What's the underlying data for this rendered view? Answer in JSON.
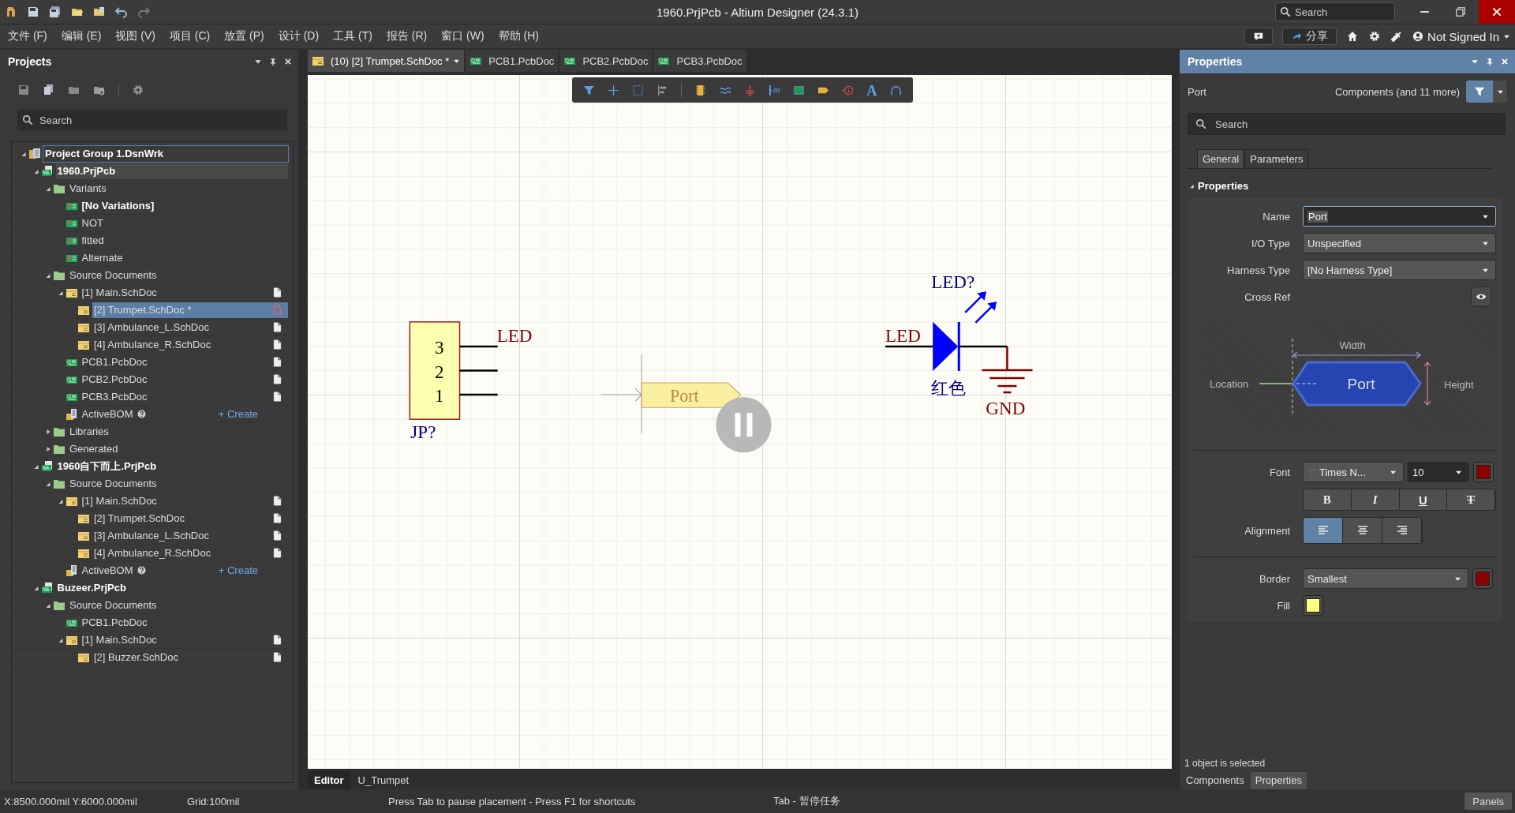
{
  "window": {
    "title": "1960.PrjPcb - Altium Designer (24.3.1)",
    "search_placeholder": "Search"
  },
  "header_actions": {
    "share": "分享",
    "account": "Not Signed In"
  },
  "menu": [
    "文件 (F)",
    "编辑 (E)",
    "视图 (V)",
    "项目 (C)",
    "放置 (P)",
    "设计 (D)",
    "工具 (T)",
    "报告 (R)",
    "窗口 (W)",
    "帮助 (H)"
  ],
  "projects_panel": {
    "title": "Projects",
    "search_placeholder": "Search",
    "tree": [
      {
        "label": "Project Group 1.DsnWrk",
        "kind": "group",
        "expanded": true,
        "selected": false,
        "children": [
          {
            "label": "1960.PrjPcb",
            "kind": "project",
            "expanded": true,
            "active": true,
            "selected": false,
            "children": [
              {
                "label": "Variants",
                "kind": "folder",
                "expanded": true,
                "selected": false,
                "children": [
                  {
                    "label": "[No Variations]",
                    "kind": "variant",
                    "active": true,
                    "selected": false
                  },
                  {
                    "label": "NOT",
                    "kind": "variant",
                    "active": false,
                    "selected": false
                  },
                  {
                    "label": "fitted",
                    "kind": "variant",
                    "active": false,
                    "selected": false
                  },
                  {
                    "label": "Alternate",
                    "kind": "variant",
                    "active": false,
                    "selected": false
                  }
                ]
              },
              {
                "label": "Source Documents",
                "kind": "folder",
                "expanded": true,
                "selected": false,
                "children": [
                  {
                    "label": "[1] Main.SchDoc",
                    "kind": "sch",
                    "modified": false,
                    "expanded": true,
                    "selected": false,
                    "children": [
                      {
                        "label": "[2] Trumpet.SchDoc *",
                        "kind": "sch",
                        "modified": true,
                        "selected": true
                      },
                      {
                        "label": "[3] Ambulance_L.SchDoc",
                        "kind": "sch",
                        "modified": false,
                        "selected": false
                      },
                      {
                        "label": "[4] Ambulance_R.SchDoc",
                        "kind": "sch",
                        "modified": false,
                        "selected": false
                      }
                    ]
                  },
                  {
                    "label": "PCB1.PcbDoc",
                    "kind": "pcb",
                    "modified": false,
                    "selected": false
                  },
                  {
                    "label": "PCB2.PcbDoc",
                    "kind": "pcb",
                    "modified": false,
                    "selected": false
                  },
                  {
                    "label": "PCB3.PcbDoc",
                    "kind": "pcb",
                    "modified": false,
                    "selected": false
                  },
                  {
                    "label": "ActiveBOM",
                    "kind": "bom",
                    "action": "+ Create",
                    "selected": false
                  }
                ]
              },
              {
                "label": "Libraries",
                "kind": "folder",
                "expanded": false,
                "selected": false
              },
              {
                "label": "Generated",
                "kind": "folder",
                "expanded": false,
                "selected": false
              }
            ]
          },
          {
            "label": "1960自下而上.PrjPcb",
            "kind": "project",
            "expanded": true,
            "active": false,
            "selected": false,
            "children": [
              {
                "label": "Source Documents",
                "kind": "folder",
                "expanded": true,
                "selected": false,
                "children": [
                  {
                    "label": "[1] Main.SchDoc",
                    "kind": "sch",
                    "modified": false,
                    "expanded": true,
                    "selected": false,
                    "children": [
                      {
                        "label": "[2] Trumpet.SchDoc",
                        "kind": "sch",
                        "modified": false,
                        "selected": false
                      },
                      {
                        "label": "[3] Ambulance_L.SchDoc",
                        "kind": "sch",
                        "modified": false,
                        "selected": false
                      },
                      {
                        "label": "[4] Ambulance_R.SchDoc",
                        "kind": "sch",
                        "modified": false,
                        "selected": false
                      }
                    ]
                  },
                  {
                    "label": "ActiveBOM",
                    "kind": "bom",
                    "action": "+ Create",
                    "selected": false
                  }
                ]
              }
            ]
          },
          {
            "label": "Buzeer.PrjPcb",
            "kind": "project",
            "expanded": true,
            "active": false,
            "selected": false,
            "children": [
              {
                "label": "Source Documents",
                "kind": "folder",
                "expanded": true,
                "selected": false,
                "children": [
                  {
                    "label": "PCB1.PcbDoc",
                    "kind": "pcb",
                    "selected": false
                  },
                  {
                    "label": "[1] Main.SchDoc",
                    "kind": "sch",
                    "modified": false,
                    "expanded": true,
                    "selected": false,
                    "children": [
                      {
                        "label": "[2] Buzzer.SchDoc",
                        "kind": "sch",
                        "modified": false,
                        "selected": false
                      }
                    ]
                  }
                ]
              }
            ]
          }
        ]
      }
    ]
  },
  "document_tabs": [
    {
      "label": "(10) [2] Trumpet.SchDoc *",
      "kind": "sch",
      "selected": true
    },
    {
      "label": "PCB1.PcbDoc",
      "kind": "pcb",
      "selected": false
    },
    {
      "label": "PCB2.PcbDoc",
      "kind": "pcb",
      "selected": false
    },
    {
      "label": "PCB3.PcbDoc",
      "kind": "pcb",
      "selected": false
    }
  ],
  "schematic_toolbar": {
    "text_tool": "A"
  },
  "schematic": {
    "connector": {
      "designator": "JP?",
      "pins": [
        "3",
        "2",
        "1"
      ],
      "net_label": "LED"
    },
    "port": {
      "name": "Port"
    },
    "led": {
      "designator": "LED?",
      "net_label": "LED",
      "comment": "红色",
      "power_port": "GND"
    }
  },
  "editor_tabs": [
    {
      "label": "Editor",
      "selected": true
    },
    {
      "label": "U_Trumpet",
      "selected": false
    }
  ],
  "properties_panel": {
    "title": "Properties",
    "object": "Port",
    "filter": "Components (and 11 more)",
    "search_placeholder": "Search",
    "tabs": [
      {
        "label": "General",
        "selected": true
      },
      {
        "label": "Parameters",
        "selected": false
      }
    ],
    "section": "Properties",
    "fields": [
      {
        "label": "Name",
        "kind": "input",
        "value": "Port"
      },
      {
        "label": "I/O Type",
        "kind": "select",
        "value": "Unspecified"
      },
      {
        "label": "Harness Type",
        "kind": "select",
        "value": "[No Harness Type]"
      },
      {
        "label": "Cross Ref",
        "kind": "eye"
      }
    ],
    "diagram": {
      "width": "Width",
      "location": "Location",
      "port": "Port",
      "height": "Height"
    },
    "font": {
      "label": "Font",
      "family": "Times N...",
      "size": "10",
      "color": "#8b0000"
    },
    "styles": [
      {
        "kind": "bold",
        "glyph": "B"
      },
      {
        "kind": "italic",
        "glyph": "I"
      },
      {
        "kind": "underline",
        "glyph": "U"
      },
      {
        "kind": "strike",
        "glyph": "T"
      }
    ],
    "alignment": {
      "label": "Alignment",
      "options": [
        {
          "kind": "left",
          "selected": true
        },
        {
          "kind": "center",
          "selected": false
        },
        {
          "kind": "right",
          "selected": false
        }
      ]
    },
    "border": {
      "label": "Border",
      "value": "Smallest",
      "color": "#8b0000"
    },
    "fill": {
      "label": "Fill",
      "color": "#ffff80"
    },
    "selection_info": "1 object is selected",
    "bottom_tabs": [
      {
        "label": "Components",
        "selected": false
      },
      {
        "label": "Properties",
        "selected": true
      }
    ]
  },
  "status_bar": {
    "coordinates": "X:8500.000mil Y:6000.000mil",
    "grid": "Grid:100mil",
    "hint": "Press Tab to pause placement - Press F1 for shortcuts",
    "task": "Tab - 暂停任务",
    "panels": "Panels"
  }
}
